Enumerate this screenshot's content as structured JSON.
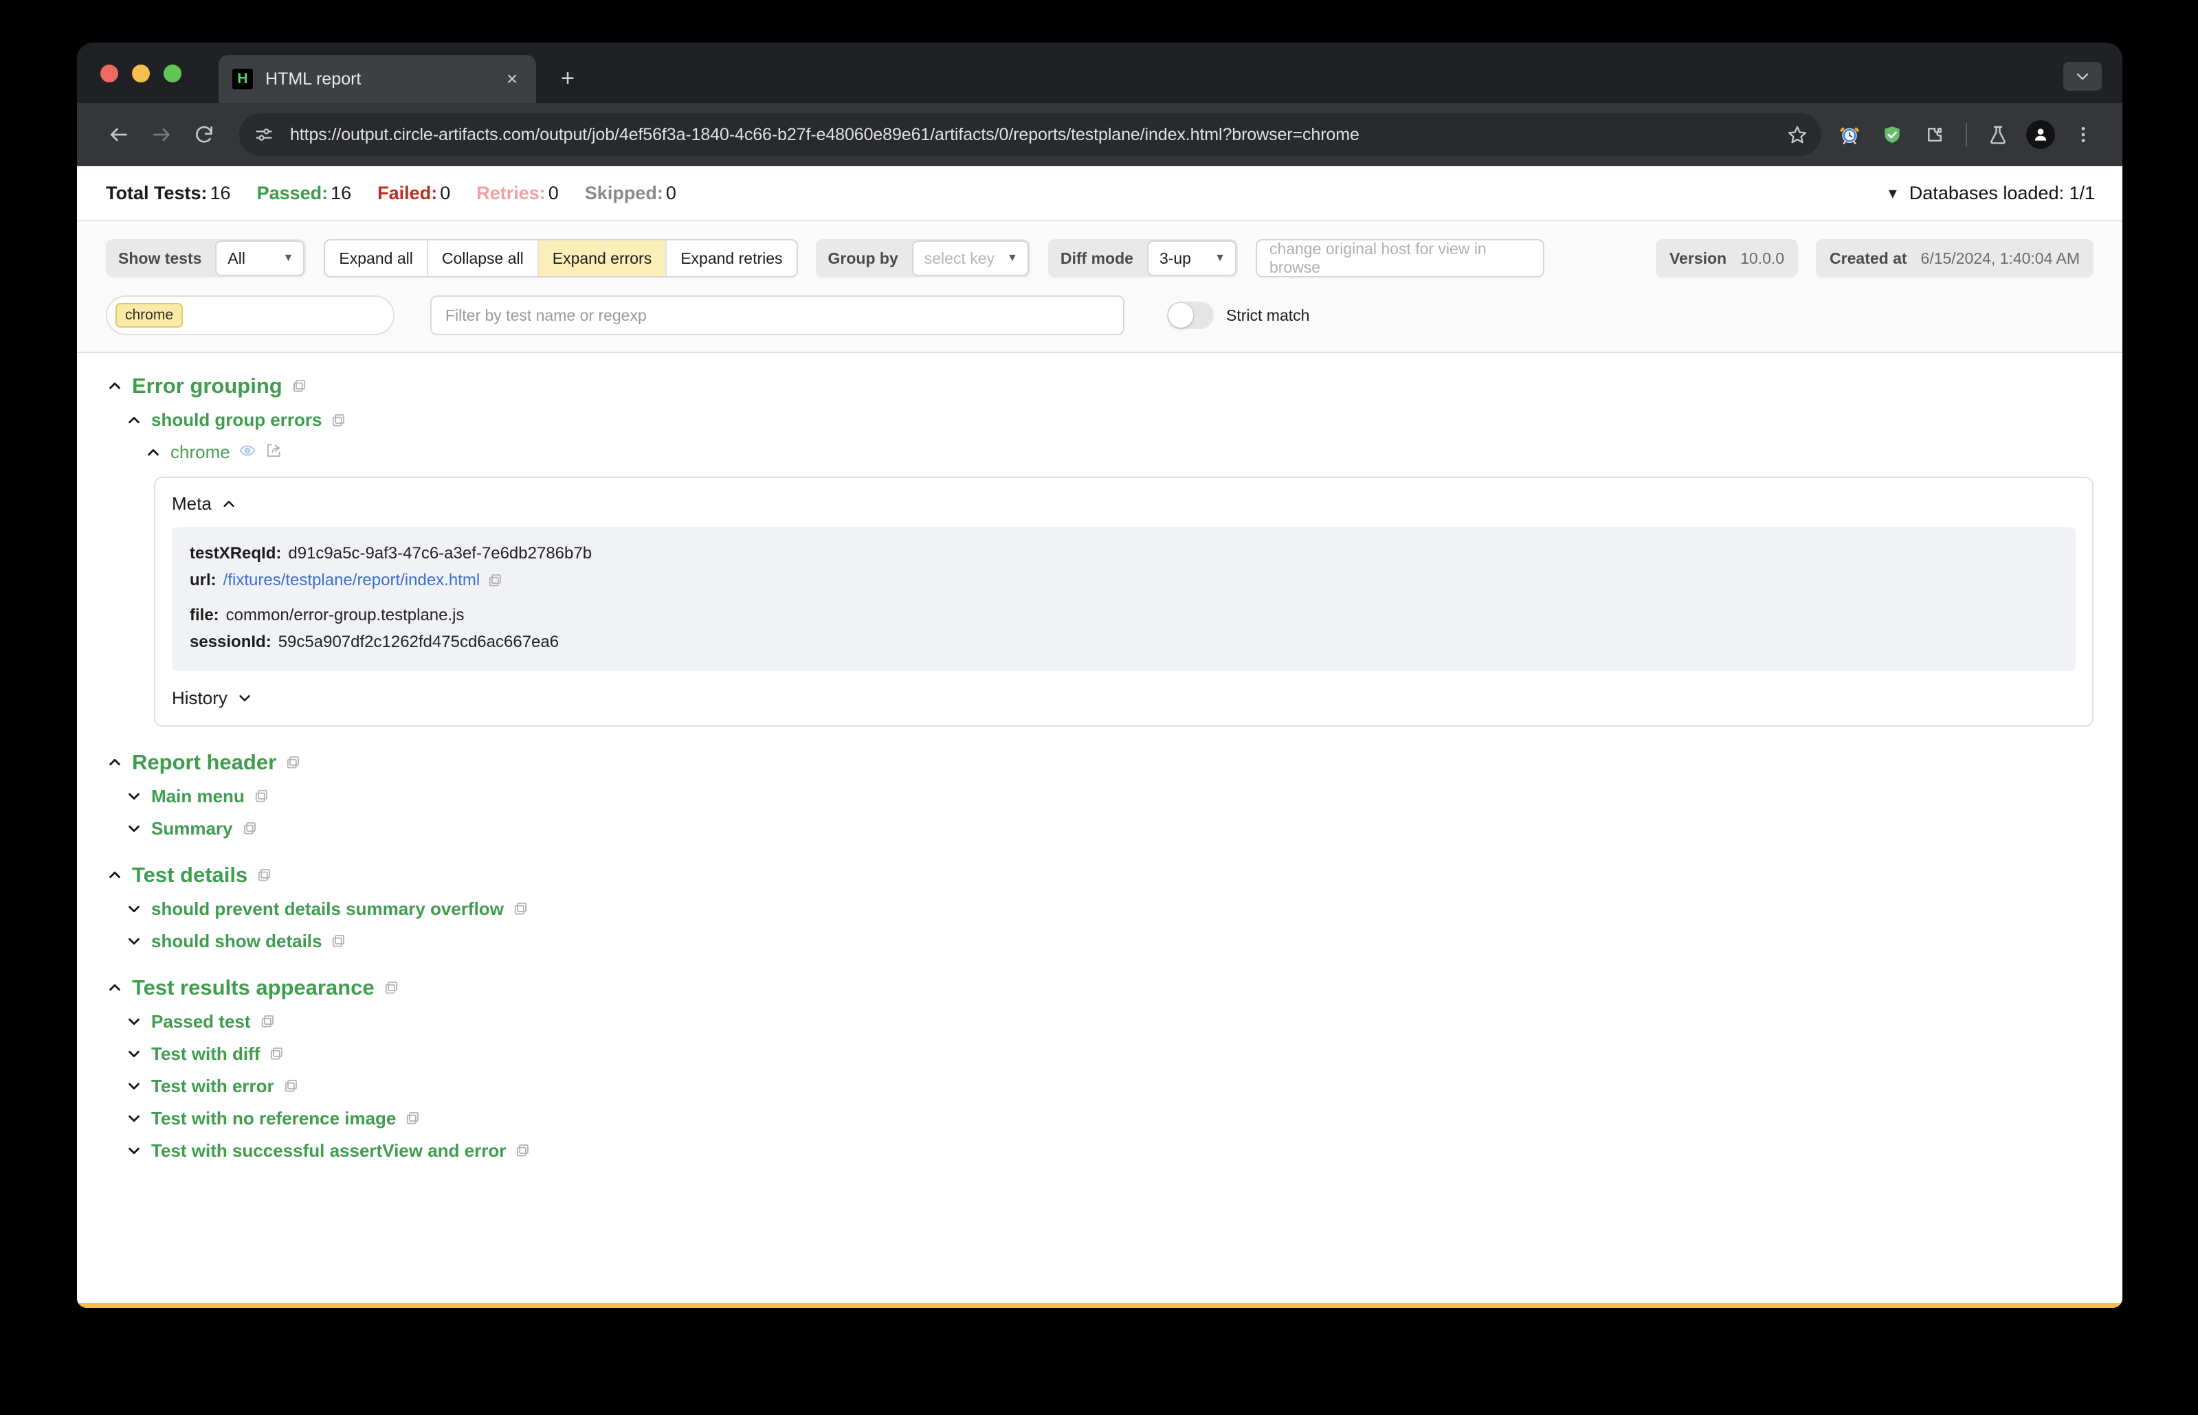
{
  "browser": {
    "tab": {
      "favicon_letter": "H",
      "title": "HTML report"
    },
    "new_tab_label": "+",
    "close_label": "×",
    "url": "https://output.circle-artifacts.com/output/job/4ef56f3a-1840-4c66-b27f-e48060e89e61/artifacts/0/reports/testplane/index.html?browser=chrome",
    "icons": {
      "back": "back-arrow-icon",
      "forward": "forward-arrow-icon",
      "reload": "reload-icon",
      "site_info": "site-settings-icon",
      "bookmark": "bookmark-star-icon",
      "alarm": "alarm-clock-icon",
      "shield": "adblock-shield-icon",
      "extensions": "extensions-puzzle-icon",
      "labs": "labs-flask-icon",
      "profile": "profile-avatar-icon",
      "menu": "three-dot-menu-icon",
      "tab_list": "tab-search-chevron-icon"
    }
  },
  "summary": {
    "stats": [
      {
        "label": "Total Tests:",
        "value": "16",
        "kind": "total"
      },
      {
        "label": "Passed:",
        "value": "16",
        "kind": "passed"
      },
      {
        "label": "Failed:",
        "value": "0",
        "kind": "failed"
      },
      {
        "label": "Retries:",
        "value": "0",
        "kind": "retries"
      },
      {
        "label": "Skipped:",
        "value": "0",
        "kind": "skipped"
      }
    ],
    "databases_loaded": "Databases loaded: 1/1"
  },
  "toolbar": {
    "show_tests_label": "Show tests",
    "show_tests_value": "All",
    "expand_all": "Expand all",
    "collapse_all": "Collapse all",
    "expand_errors": "Expand errors",
    "expand_retries": "Expand retries",
    "group_by_label": "Group by",
    "group_by_placeholder": "select key",
    "diff_mode_label": "Diff mode",
    "diff_mode_value": "3-up",
    "host_placeholder": "change original host for view in browse",
    "version_label": "Version",
    "version_value": "10.0.0",
    "created_at_label": "Created at",
    "created_at_value": "6/15/2024, 1:40:04 AM"
  },
  "filters": {
    "browser_chip": "chrome",
    "test_filter_placeholder": "Filter by test name or regexp",
    "strict_match_label": "Strict match"
  },
  "tree": {
    "error_grouping": {
      "suite": "Error grouping",
      "test": "should group errors",
      "browser": "chrome",
      "meta_label": "Meta",
      "meta": [
        {
          "key": "testXReqId:",
          "value": "d91c9a5c-9af3-47c6-a3ef-7e6db2786b7b",
          "link": false
        },
        {
          "key": "url:",
          "value": "/fixtures/testplane/report/index.html",
          "link": true
        },
        {
          "key": "file:",
          "value": "common/error-group.testplane.js",
          "link": false
        },
        {
          "key": "sessionId:",
          "value": "59c5a907df2c1262fd475cd6ac667ea6",
          "link": false
        }
      ],
      "history_label": "History"
    },
    "report_header": {
      "suite": "Report header",
      "tests": [
        "Main menu",
        "Summary"
      ]
    },
    "test_details": {
      "suite": "Test details",
      "tests": [
        "should prevent details summary overflow",
        "should show details"
      ]
    },
    "test_results_appearance": {
      "suite": "Test results appearance",
      "tests": [
        "Passed test",
        "Test with diff",
        "Test with error",
        "Test with no reference image",
        "Test with successful assertView and error"
      ]
    }
  },
  "colors": {
    "green": "#3f9d4e",
    "red": "#c52a1e",
    "accent_yellow": "#fbeeb8",
    "bottom_border": "#f2c14a",
    "link_blue": "#3d6fd0"
  }
}
